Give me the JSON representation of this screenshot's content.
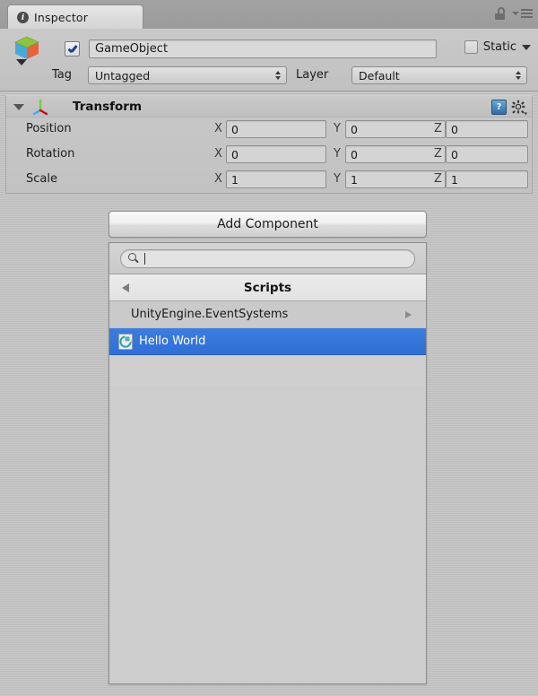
{
  "window": {
    "tab_label": "Inspector",
    "tab_icon": "info-icon",
    "lock_icon": "lock-open-icon",
    "menu_icon": "hamburger-menu-icon"
  },
  "object_header": {
    "icon": "gameobject-cube-icon",
    "enabled_checkbox": true,
    "name_value": "GameObject",
    "name_placeholder": "Name",
    "static_label": "Static",
    "static_checked": false,
    "tag_label": "Tag",
    "tag_value": "Untagged",
    "layer_label": "Layer",
    "layer_value": "Default"
  },
  "transform": {
    "title": "Transform",
    "icon": "transform-axis-gizmo-icon",
    "help_icon": "help-book-icon",
    "help_glyph": "?",
    "settings_icon": "gear-icon",
    "expanded": true,
    "rows": [
      {
        "label": "Position",
        "x_label": "X",
        "x": "0",
        "y_label": "Y",
        "y": "0",
        "z_label": "Z",
        "z": "0"
      },
      {
        "label": "Rotation",
        "x_label": "X",
        "x": "0",
        "y_label": "Y",
        "y": "0",
        "z_label": "Z",
        "z": "0"
      },
      {
        "label": "Scale",
        "x_label": "X",
        "x": "1",
        "y_label": "Y",
        "y": "1",
        "z_label": "Z",
        "z": "1"
      }
    ]
  },
  "add_component": {
    "button_label": "Add Component",
    "search": {
      "icon": "search-icon",
      "value": "",
      "placeholder": ""
    },
    "breadcrumb": {
      "back_icon": "back-arrow-icon",
      "title": "Scripts"
    },
    "items": [
      {
        "label": "UnityEngine.EventSystems",
        "has_submenu": true,
        "submenu_icon": "right-arrow-icon",
        "selected": false,
        "icon": null
      },
      {
        "label": "Hello World",
        "has_submenu": false,
        "submenu_icon": null,
        "selected": true,
        "icon": "csharp-script-icon"
      }
    ]
  },
  "colors": {
    "selection_blue": "#3472d8",
    "panel_bg": "#c2c2c2",
    "tabbar_bg": "#9e9e9e",
    "field_bg": "#d4d4d4",
    "cube_green": "#7cc24a",
    "cube_blue": "#4aa8d8",
    "cube_orange": "#e8633a"
  }
}
